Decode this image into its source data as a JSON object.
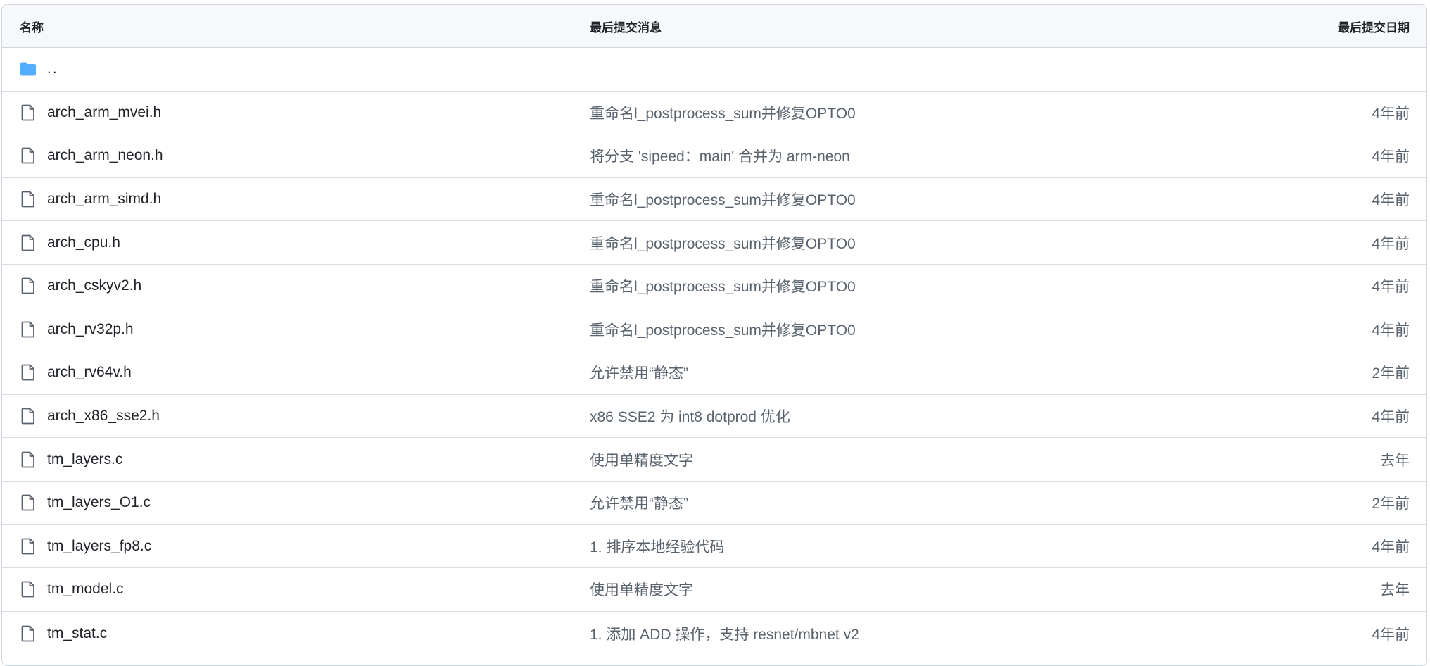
{
  "header": {
    "name": "名称",
    "message": "最后提交消息",
    "date": "最后提交日期"
  },
  "parent": {
    "label": "..",
    "icon": "folder-icon"
  },
  "rows": [
    {
      "name": "arch_arm_mvei.h",
      "message": "重命名l_postprocess_sum并修复OPTO0",
      "date": "4年前"
    },
    {
      "name": "arch_arm_neon.h",
      "message": "将分支 'sipeed：main' 合并为 arm-neon",
      "date": "4年前"
    },
    {
      "name": "arch_arm_simd.h",
      "message": "重命名l_postprocess_sum并修复OPTO0",
      "date": "4年前"
    },
    {
      "name": "arch_cpu.h",
      "message": "重命名l_postprocess_sum并修复OPTO0",
      "date": "4年前"
    },
    {
      "name": "arch_cskyv2.h",
      "message": "重命名l_postprocess_sum并修复OPTO0",
      "date": "4年前"
    },
    {
      "name": "arch_rv32p.h",
      "message": "重命名l_postprocess_sum并修复OPTO0",
      "date": "4年前"
    },
    {
      "name": "arch_rv64v.h",
      "message": "允许禁用“静态”",
      "date": "2年前"
    },
    {
      "name": "arch_x86_sse2.h",
      "message": "x86 SSE2 为 int8 dotprod 优化",
      "date": "4年前"
    },
    {
      "name": "tm_layers.c",
      "message": "使用单精度文字",
      "date": "去年"
    },
    {
      "name": "tm_layers_O1.c",
      "message": "允许禁用“静态”",
      "date": "2年前"
    },
    {
      "name": "tm_layers_fp8.c",
      "message": "1. 排序本地经验代码",
      "date": "4年前"
    },
    {
      "name": "tm_model.c",
      "message": "使用单精度文字",
      "date": "去年"
    },
    {
      "name": "tm_stat.c",
      "message": "1. 添加 ADD 操作，支持 resnet/mbnet v2",
      "date": "4年前"
    }
  ],
  "colors": {
    "folder": "#54aeff",
    "file_icon": "#59636e",
    "border": "#d0d7de",
    "header_bg": "#f6f8fa"
  }
}
